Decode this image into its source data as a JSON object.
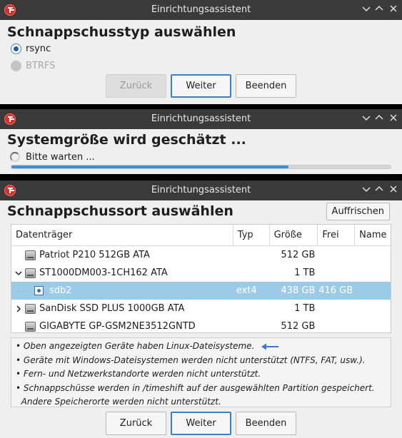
{
  "window_title": "Einrichtungsassistent",
  "step1": {
    "heading": "Schnappschusstyp auswählen",
    "options": [
      {
        "label": "rsync",
        "checked": true,
        "disabled": false
      },
      {
        "label": "BTRFS",
        "checked": false,
        "disabled": true
      }
    ],
    "buttons": {
      "back": "Zurück",
      "next": "Weiter",
      "finish": "Beenden"
    }
  },
  "step2": {
    "heading": "Systemgröße wird geschätzt ...",
    "status": "Bitte warten ...",
    "progress": 0.73
  },
  "step3": {
    "heading": "Schnappschussort auswählen",
    "refresh_label": "Auffrischen",
    "columns": [
      "Datenträger",
      "Typ",
      "Größe",
      "Frei",
      "Name"
    ],
    "rows": [
      {
        "name": "Patriot P210 512GB ATA",
        "type": "",
        "size": "512 GB",
        "free": "",
        "label": "",
        "kind": "drive",
        "expander": ""
      },
      {
        "name": "ST1000DM003-1CH162 ATA",
        "type": "",
        "size": "1 TB",
        "free": "",
        "label": "",
        "kind": "drive",
        "expander": "expanded"
      },
      {
        "name": "sdb2",
        "type": "ext4",
        "size": "438 GB",
        "free": "416 GB",
        "label": "",
        "kind": "partition",
        "expander": "",
        "selected": true
      },
      {
        "name": "SanDisk SSD PLUS 1000GB ATA",
        "type": "",
        "size": "1 TB",
        "free": "",
        "label": "",
        "kind": "drive",
        "expander": "collapsed"
      },
      {
        "name": "GIGABYTE GP-GSM2NE3512GNTD",
        "type": "",
        "size": "512 GB",
        "free": "",
        "label": "",
        "kind": "drive",
        "expander": ""
      }
    ],
    "notes": [
      "• Oben angezeigten Geräte haben Linux-Dateisysteme.",
      "• Geräte mit Windows-Dateisystemen werden nicht unterstützt (NTFS, FAT, usw.).",
      "• Fern- und Netzwerkstandorte werden nicht unterstützt.",
      "• Schnappschüsse werden in /timeshift auf der ausgewählten Partition gespeichert.",
      "  Andere Speicherorte werden nicht unterstützt."
    ],
    "buttons": {
      "back": "Zurück",
      "next": "Weiter",
      "finish": "Beenden"
    }
  },
  "colors": {
    "accent": "#3d7fc4",
    "titlebar": "#3a3a3a",
    "selection": "#9ccbe8",
    "arrow": "#3a78c8"
  }
}
